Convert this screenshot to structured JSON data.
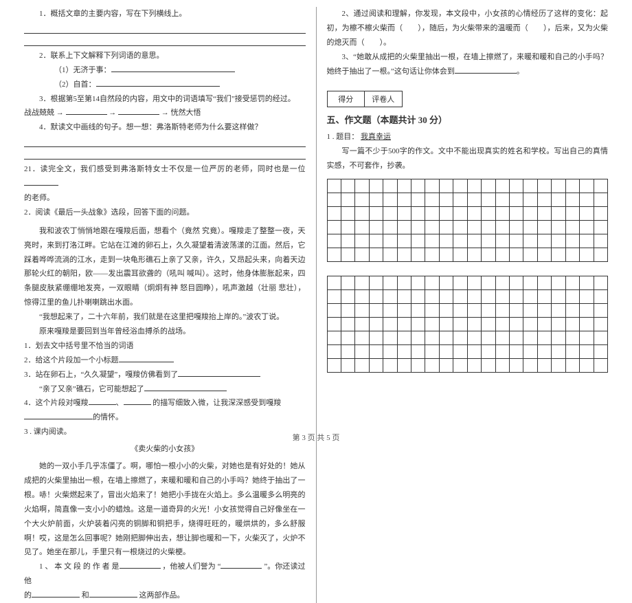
{
  "left": {
    "q1_1": "1．概括文章的主要内容，写在下列横线上。",
    "q1_2": "2．联系上下文解释下列词语的意思。",
    "q1_2a": "（1）无济于事：",
    "q1_2b": "（2）自首：",
    "q1_3a": "3．根据第5至第14自然段的内容，用文中的词语填写“我们”接受惩罚的经过。",
    "q1_3b": "战战兢兢 →",
    "q1_3arrow2": "→",
    "q1_3arrow3": "→ 恍然大悟",
    "q1_4": "4．默读文中画线的句子。想一想：弗洛斯特老师为什么要这样做？",
    "q21": "21．读完全文，我们感受到弗洛斯特女士不仅是一位严厉的老师，同时也是一位",
    "q21b": "的老师。",
    "p2intro": "2．阅读《最后一头战象》选段，回答下面的问题。",
    "p2a": "我和波农丁悄悄地跟在嘎羧后面，想看个（竟然 究竟）。嘎羧走了整整一夜，天亮时，来到打洛江畔。它站在江滩的卵石上，久久凝望着清波荡漾的江面。然后，它踩着哗哗流淌的江水，走到一块龟形礁石上亲了又亲，许久，又昂起头来，向着天边那轮火红的朝阳，欧——发出震耳欲聋的（吼叫 喊叫）。这时，他身体膨胀起来，四条腿皮肤紧绷绷地发亮，一双眼睛（炯炯有神 怒目圆睁），吼声激越（壮丽 悲壮），惊得江里的鱼儿扑喇喇跳出水面。",
    "p2b": "“我想起来了，二十六年前，我们就是在这里把嘎羧抬上岸的。”波农丁说。",
    "p2c": "原来嘎羧是要回到当年曾经浴血搏杀的战场。",
    "q2_1": "1．划去文中括号里不恰当的词语",
    "q2_2": "2．给这个片段加一个小标题",
    "q2_3a": "3．站在卵石上，“久久凝望”，嘎羧仿佛看到了",
    "q2_3b": "“亲了又亲”礁石，它可能想起了",
    "q2_4a": "4．这个片段对嘎羧",
    "q2_4b": "的描写细致入微，让我深深感受到嘎羧",
    "q2_4c": "的情怀。",
    "p3intro": "3 . 课内阅读。",
    "p3title": "《卖火柴的小女孩》",
    "p3a": "她的一双小手几乎冻僵了。啊，哪怕一根小小的火柴，对她也是有好处的！她从成把的火柴里抽出一根，在墙上擦燃了，来暖和暖和自己的小手吗？她终于抽出了一根。哧！火柴燃起来了，冒出火焰来了！她把小手拢在火焰上。多么温暖多么明亮的火焰啊，简直像一支小小的蜡烛。这是一道奇异的火光！小女孩觉得自己好像坐在一个大火炉前面，火炉装着闪亮的铜脚和铜把手，烧得旺旺的，暖烘烘的，多么舒服啊！哎，这是怎么回事呢？她刚把脚伸出去，想让脚也暖和一下，火柴灭了，火炉不见了。她坐在那儿，手里只有一根烧过的火柴梗。",
    "p3q1a": "1 、 本 文 段 的 作 者 是",
    "p3q1b": "，他被人们誉为 “",
    "p3q1c": "”。你还读过他",
    "p3q1d": "的",
    "p3q1e": "和",
    "p3q1f": "这两部作品。"
  },
  "right": {
    "r2a": "2、通过阅读和理解，你发现，本文段中，小女孩的心情经历了这样的变化：起初，为檫不檫火柴而（　　），随后，为火柴带来的温暖而（　　），后来，又为火柴的熄灭而（　　）。",
    "r3a": "3、“她敢从成把的火柴里抽出一根，在墙上擦燃了，来暖和暖和自己的小手吗？她终于抽出了一根。”这句话让你体会到",
    "r3b": "。",
    "score1": "得分",
    "score2": "评卷人",
    "section5": "五、作文题（本题共计 30 分）",
    "essay1": "1 . 题目：",
    "essay_title": "我真幸运",
    "essay_req": "写一篇不少于500字的作文。文中不能出现真实的姓名和学校。写出自己的真情实感，不可套作，抄袭。"
  },
  "footer": "第 3 页 共 5 页"
}
